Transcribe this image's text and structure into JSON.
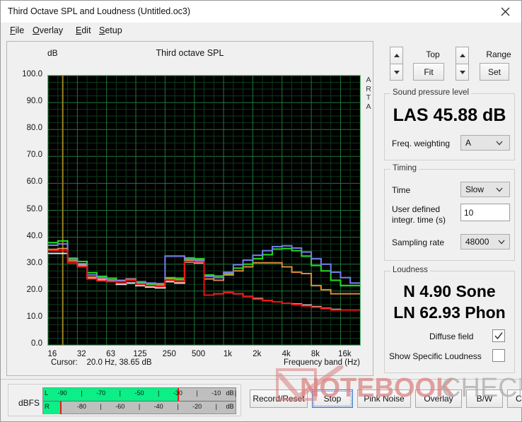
{
  "window": {
    "title": "Third Octave SPL and Loudness (Untitled.oc3)",
    "close_icon": "close-icon"
  },
  "menu": {
    "items": [
      {
        "label": "File",
        "mnemonic": "F"
      },
      {
        "label": "Overlay",
        "mnemonic": "O"
      },
      {
        "label": "Edit",
        "mnemonic": "E"
      },
      {
        "label": "Setup",
        "mnemonic": "S"
      }
    ]
  },
  "chart_panel": {
    "title": "Third octave SPL",
    "y_unit": "dB",
    "watermark_text": "ARTA",
    "cursor_label": "Cursor:",
    "cursor_value": "20.0 Hz, 38.65 dB",
    "x_axis_title": "Frequency band (Hz)"
  },
  "controls": {
    "top_label": "Top",
    "fit_button": "Fit",
    "range_label": "Range",
    "set_button": "Set",
    "spinner_up_icon": "arrow-up-icon",
    "spinner_down_icon": "arrow-down-icon",
    "spl_group": "Sound pressure level",
    "spl_value": "LAS 45.88 dB",
    "freq_weighting_label": "Freq. weighting",
    "freq_weighting_value": "A",
    "timing_group": "Timing",
    "time_label": "Time",
    "time_value": "Slow",
    "user_time_label_line1": "User defined",
    "user_time_label_line2": "integr. time (s)",
    "user_time_value": "10",
    "sampling_rate_label": "Sampling rate",
    "sampling_rate_value": "48000",
    "loudness_group": "Loudness",
    "loudness_n": "N 4.90 Sone",
    "loudness_ln": "LN 62.93 Phon",
    "diffuse_field_label": "Diffuse field",
    "diffuse_field_checked": true,
    "show_specific_label": "Show Specific Loudness",
    "show_specific_checked": false,
    "chevron_icon": "chevron-down-icon",
    "check_icon": "check-icon"
  },
  "meter": {
    "unit_label": "dBFS",
    "unit_suffix": "dB",
    "left_channel": "L",
    "right_channel": "R",
    "top_ticks": [
      "-90",
      "-70",
      "-50",
      "-30",
      "-10"
    ],
    "bottom_ticks": [
      "-80",
      "-60",
      "-40",
      "-20"
    ],
    "left_fill_pct": 70,
    "right_fill_pct": 9,
    "fill_color": "#0bef86",
    "peak_color": "#f01414"
  },
  "toolbar": {
    "buttons": [
      {
        "label": "Record/Reset",
        "focused": false
      },
      {
        "label": "Stop",
        "focused": true
      },
      {
        "label": "Pink Noise",
        "focused": false
      },
      {
        "label": "Overlay",
        "focused": false
      },
      {
        "label": "B/W",
        "focused": false
      },
      {
        "label": "Copy",
        "focused": false
      }
    ]
  },
  "watermark": {
    "text_bold": "NOTEBOOK",
    "text_light": "CHECK"
  },
  "chart_data": {
    "type": "line",
    "title": "Third octave SPL",
    "xlabel": "Frequency band (Hz)",
    "ylabel": "dB",
    "ylim": [
      0,
      100
    ],
    "ytick_step": 10,
    "yticks": [
      "0.0",
      "10.0",
      "20.0",
      "30.0",
      "40.0",
      "50.0",
      "60.0",
      "70.0",
      "80.0",
      "90.0",
      "100.0"
    ],
    "xticks": [
      "16",
      "32",
      "63",
      "125",
      "250",
      "500",
      "1k",
      "2k",
      "4k",
      "8k",
      "16k"
    ],
    "grid": true,
    "plot_bg": "#000000",
    "grid_color": "#1f7a3a",
    "cursor_freq_hz": 20.0,
    "cursor_level_db": 38.65,
    "cursor_color": "#9a8420",
    "bands_hz": [
      16,
      20,
      25,
      31.5,
      40,
      50,
      63,
      80,
      100,
      125,
      160,
      200,
      250,
      315,
      400,
      500,
      630,
      800,
      1000,
      1250,
      1600,
      2000,
      2500,
      3150,
      4000,
      5000,
      6300,
      8000,
      10000,
      12500,
      16000,
      20000
    ],
    "series": [
      {
        "name": "green",
        "color": "#20e020",
        "values": [
          38.0,
          38.6,
          32.2,
          31.0,
          26.8,
          25.5,
          24.8,
          24.0,
          24.2,
          23.0,
          22.5,
          22.0,
          25.0,
          24.8,
          32.3,
          32.0,
          26.0,
          25.6,
          26.5,
          28.5,
          30.0,
          32.0,
          33.5,
          35.6,
          35.8,
          35.0,
          33.0,
          29.5,
          27.5,
          24.0,
          22.0,
          22.0
        ]
      },
      {
        "name": "blue",
        "color": "#7a7ef0",
        "values": [
          37.0,
          37.5,
          31.8,
          30.2,
          26.0,
          25.0,
          24.2,
          24.0,
          24.3,
          23.5,
          23.0,
          22.8,
          33.0,
          33.0,
          31.8,
          31.5,
          25.5,
          25.0,
          27.0,
          29.8,
          31.5,
          33.3,
          35.0,
          36.5,
          36.8,
          36.0,
          34.5,
          32.0,
          30.0,
          27.0,
          25.0,
          23.0
        ]
      },
      {
        "name": "orange",
        "color": "#e08a3c",
        "values": [
          35.5,
          35.8,
          31.2,
          29.5,
          25.2,
          24.5,
          24.0,
          23.8,
          24.5,
          23.2,
          22.8,
          22.5,
          24.6,
          24.2,
          31.5,
          31.0,
          24.5,
          24.0,
          26.0,
          27.5,
          29.0,
          30.5,
          30.5,
          30.5,
          29.0,
          27.0,
          26.5,
          22.0,
          20.5,
          19.0,
          19.0,
          19.0
        ]
      },
      {
        "name": "red",
        "color": "#ee1111",
        "values": [
          35.0,
          35.0,
          30.5,
          29.0,
          24.5,
          23.8,
          23.5,
          23.0,
          24.0,
          22.5,
          22.0,
          21.8,
          24.0,
          23.5,
          31.0,
          30.8,
          18.5,
          19.0,
          19.5,
          19.0,
          18.0,
          17.0,
          16.5,
          16.0,
          15.5,
          15.0,
          14.5,
          14.0,
          13.5,
          13.0,
          13.0,
          13.0
        ]
      },
      {
        "name": "white",
        "color": "#e6e6e6",
        "values": [
          34.0,
          34.0,
          32.0,
          30.0,
          24.8,
          24.0,
          23.5,
          22.5,
          23.0,
          22.0,
          21.5,
          21.2,
          23.5,
          23.0,
          30.8,
          30.5,
          18.5,
          19.0,
          19.5,
          19.0,
          18.0,
          17.2,
          16.5,
          16.0,
          15.5,
          15.2,
          14.8,
          14.2,
          13.6,
          13.2,
          13.0,
          13.0
        ]
      }
    ]
  }
}
